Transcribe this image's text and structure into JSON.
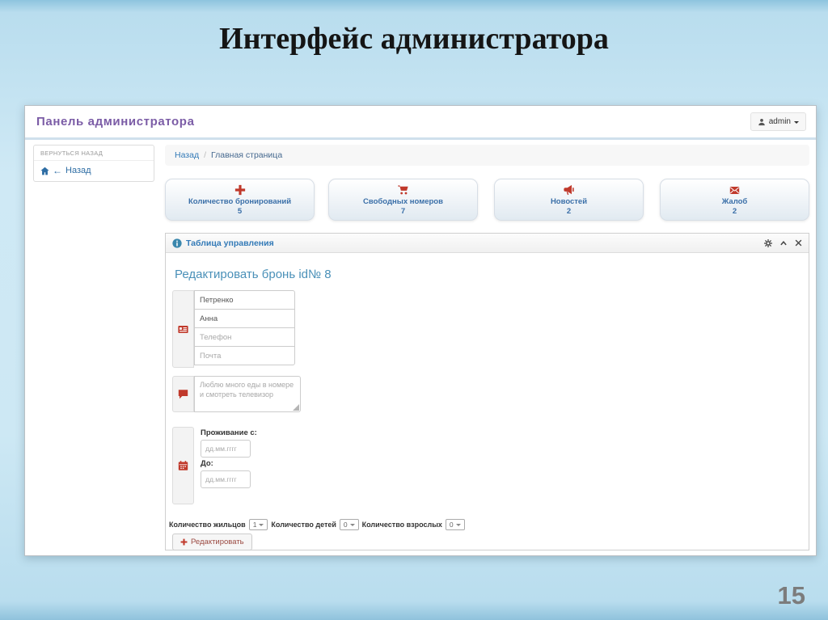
{
  "slide": {
    "title": "Интерфейс администратора",
    "page_number": "15"
  },
  "colors": {
    "accent_blue": "#337ab7",
    "brand_purple": "#7b5ca6",
    "icon_red": "#c0392b",
    "slide_background": "#cfe9f5"
  },
  "admin_panel": {
    "brand": "Панель администратора",
    "user_menu": {
      "icon": "person-icon",
      "label": "admin"
    },
    "sidebar": {
      "header": "ВЕРНУТЬСЯ НАЗАД",
      "back_icon": "home-icon",
      "back_arrow": "←",
      "back_label": "Назад"
    },
    "breadcrumb": {
      "back": "Назад",
      "separator": "/",
      "current": "Главная страница"
    },
    "stat_cards": [
      {
        "icon": "plus-icon",
        "label": "Количество бронирований",
        "value": "5"
      },
      {
        "icon": "cart-icon",
        "label": "Свободных номеров",
        "value": "7"
      },
      {
        "icon": "megaphone-icon",
        "label": "Новостей",
        "value": "2"
      },
      {
        "icon": "envelope-icon",
        "label": "Жалоб",
        "value": "2"
      }
    ],
    "panel": {
      "icon": "info-icon",
      "title": "Таблица управления",
      "window_icons": [
        "gear-icon",
        "chevron-up-icon",
        "close-icon"
      ],
      "form": {
        "heading": "Редактировать бронь id№ 8",
        "fields": {
          "group_icon": "id-card-icon",
          "last_name_value": "Петренко",
          "first_name_value": "Анна",
          "phone_placeholder": "Телефон",
          "email_placeholder": "Почта"
        },
        "comment": {
          "group_icon": "comment-icon",
          "placeholder": "Люблю много еды в номере и смотреть телевизор"
        },
        "dates": {
          "group_icon": "calendar-icon",
          "from_label": "Проживание с:",
          "to_label": "До:",
          "placeholder": "дд.мм.гггг"
        },
        "counts": [
          {
            "label": "Количество жильцов",
            "value": "1"
          },
          {
            "label": "Количество детей",
            "value": "0"
          },
          {
            "label": "Количество взрослых",
            "value": "0"
          }
        ],
        "submit_icon": "plus-icon",
        "submit_label": "Редактировать"
      }
    }
  }
}
